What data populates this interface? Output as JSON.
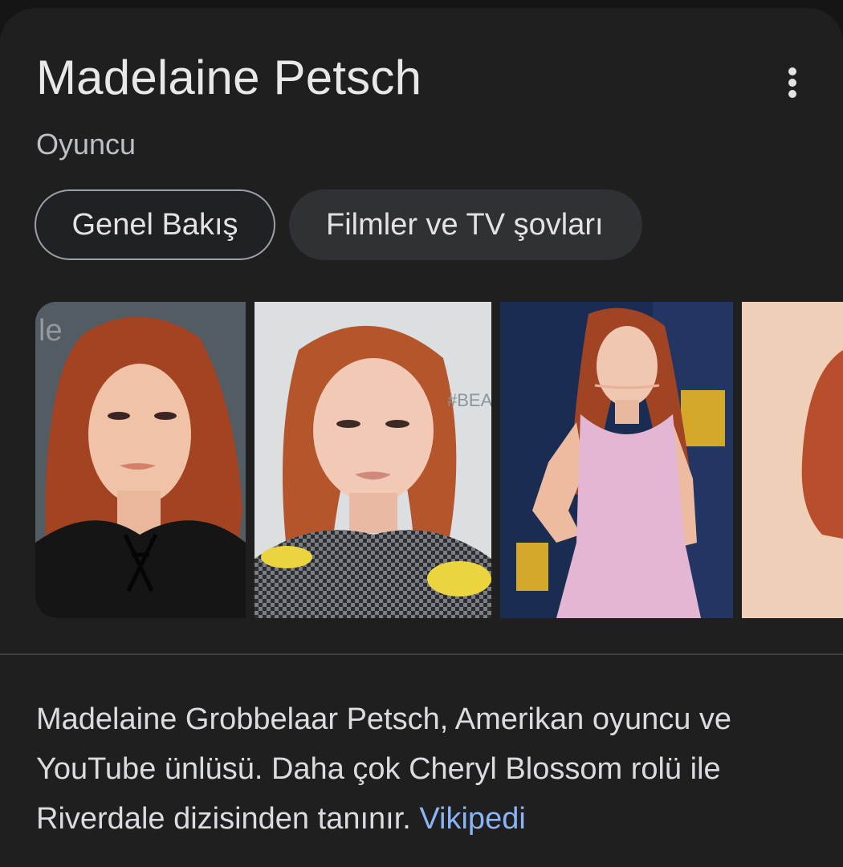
{
  "knowledge_panel": {
    "title": "Madelaine Petsch",
    "subtitle": "Oyuncu",
    "more_menu_icon": "more-vert-icon",
    "tabs": [
      {
        "label": "Genel Bakış",
        "selected": true
      },
      {
        "label": "Filmler ve TV şovları",
        "selected": false
      }
    ],
    "description": "Madelaine Grobbelaar Petsch, Amerikan oyuncu ve YouTube ünlüsü. Daha çok Cheryl Blossom rolü ile Riverdale dizisinden tanınır.",
    "source_link": "Vikipedi"
  },
  "colors": {
    "background": "#1f1f1f",
    "title": "#e8e8e8",
    "subtitle": "#bdc1c6",
    "link": "#8ab4f8",
    "chip_selected_border": "#9aa0a6",
    "chip_background": "#303134"
  }
}
